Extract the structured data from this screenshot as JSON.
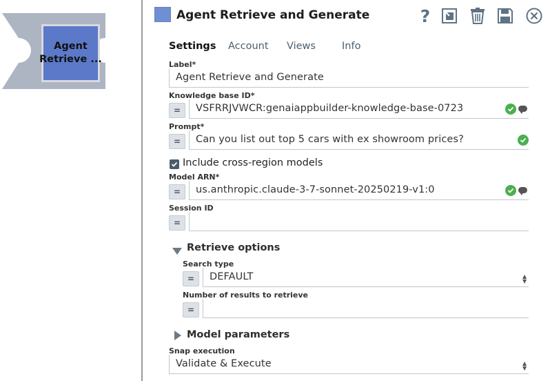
{
  "snap": {
    "label_line1": "Agent",
    "label_line2": "Retrieve ...",
    "color": "#5b79c8"
  },
  "header": {
    "title": "Agent Retrieve and Generate",
    "icons": [
      "help-icon",
      "export-icon",
      "delete-icon",
      "save-icon",
      "close-icon"
    ]
  },
  "tabs": [
    "Settings",
    "Account",
    "Views",
    "Info"
  ],
  "form": {
    "label": {
      "caption": "Label*",
      "value": "Agent Retrieve and Generate"
    },
    "kb": {
      "caption": "Knowledge base ID*",
      "value": "VSFRRJVWCR:genaiappbuilder-knowledge-base-0723"
    },
    "prompt": {
      "caption": "Prompt*",
      "value": "Can you list out top 5 cars with ex showroom prices?"
    },
    "cross_region": {
      "caption": "Include cross-region models",
      "checked": true
    },
    "model_arn": {
      "caption": "Model ARN*",
      "value": "us.anthropic.claude-3-7-sonnet-20250219-v1:0"
    },
    "session": {
      "caption": "Session ID",
      "value": ""
    },
    "retrieve": {
      "title": "Retrieve options",
      "search_type": {
        "caption": "Search type",
        "value": "DEFAULT"
      },
      "num_results": {
        "caption": "Number of results to retrieve",
        "value": ""
      }
    },
    "model_params": {
      "title": "Model parameters"
    },
    "snap_exec": {
      "caption": "Snap execution",
      "value": "Validate & Execute"
    }
  },
  "eq_symbol": "=",
  "colors": {
    "accent": "#5b79c8",
    "valid": "#4caf50",
    "icon": "#5f7385"
  }
}
